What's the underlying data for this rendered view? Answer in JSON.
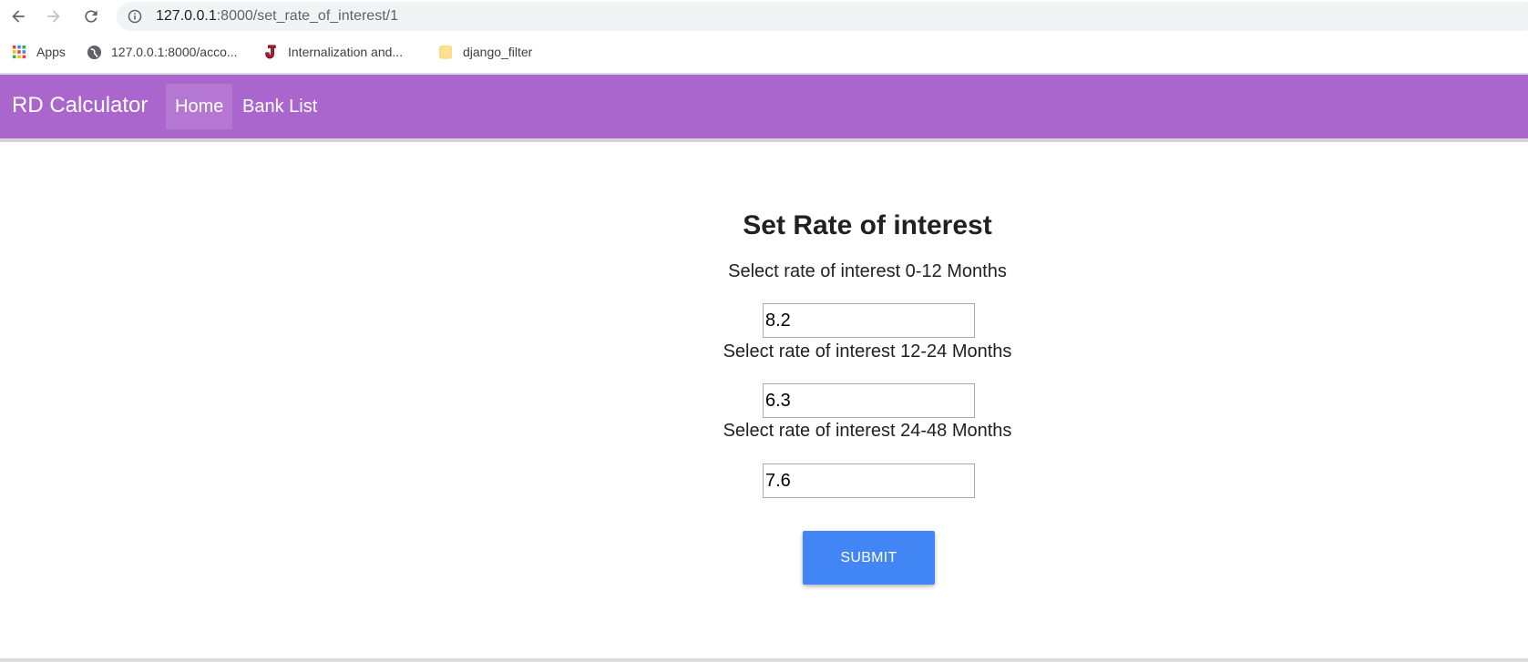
{
  "browser": {
    "url_host": "127.0.0.1",
    "url_rest": ":8000/set_rate_of_interest/1",
    "bookmarks": [
      {
        "label": "Apps",
        "icon": "apps-grid-icon"
      },
      {
        "label": "127.0.0.1:8000/acco...",
        "icon": "globe-icon"
      },
      {
        "label": "Internalization and...",
        "icon": "j-logo-icon"
      },
      {
        "label": "django_filter",
        "icon": "folder-icon"
      }
    ]
  },
  "navbar": {
    "brand": "RD Calculator",
    "items": [
      {
        "label": "Home",
        "active": true
      },
      {
        "label": "Bank List",
        "active": false
      }
    ],
    "color": "#aa66cd"
  },
  "form": {
    "title": "Set Rate of interest",
    "fields": [
      {
        "label": "Select rate of interest 0-12 Months",
        "value": "8.2"
      },
      {
        "label": "Select rate of interest 12-24 Months",
        "value": "6.3"
      },
      {
        "label": "Select rate of interest 24-48 Months",
        "value": "7.6"
      }
    ],
    "submit_label": "SUBMIT",
    "submit_color": "#4285f4"
  }
}
